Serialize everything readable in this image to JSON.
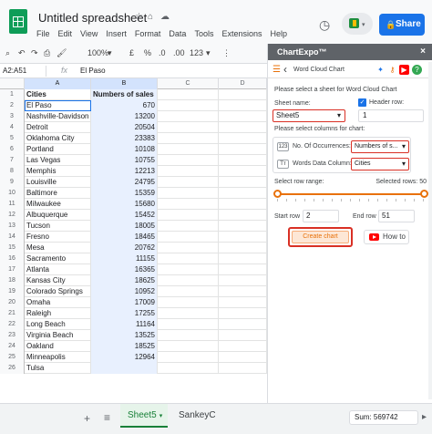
{
  "app": {
    "title": "Untitled spreadsheet",
    "share_label": "Share",
    "menus": [
      "File",
      "Edit",
      "View",
      "Insert",
      "Format",
      "Data",
      "Tools",
      "Extensions",
      "Help"
    ]
  },
  "toolbar": {
    "zoom": "100%",
    "currency": "£",
    "percent": "%",
    "decimal_dec": ".0",
    "decimal_inc": ".00",
    "number_format": "123"
  },
  "formula_bar": {
    "name_box": "A2:A51",
    "fx": "fx",
    "value": "El Paso"
  },
  "grid": {
    "columns": [
      "A",
      "B",
      "C",
      "D"
    ],
    "header": {
      "a": "Cities",
      "b": "Numbers of sales"
    },
    "rows": [
      {
        "n": "2",
        "city": "El Paso",
        "sales": "670"
      },
      {
        "n": "3",
        "city": "Nashville-Davidson",
        "sales": "13200"
      },
      {
        "n": "4",
        "city": "Detroit",
        "sales": "20504"
      },
      {
        "n": "5",
        "city": "Oklahoma City",
        "sales": "23383"
      },
      {
        "n": "6",
        "city": "Portland",
        "sales": "10108"
      },
      {
        "n": "7",
        "city": "Las Vegas",
        "sales": "10755"
      },
      {
        "n": "8",
        "city": "Memphis",
        "sales": "12213"
      },
      {
        "n": "9",
        "city": "Louisville",
        "sales": "24795"
      },
      {
        "n": "10",
        "city": "Baltimore",
        "sales": "15359"
      },
      {
        "n": "11",
        "city": "Milwaukee",
        "sales": "15680"
      },
      {
        "n": "12",
        "city": "Albuquerque",
        "sales": "15452"
      },
      {
        "n": "13",
        "city": "Tucson",
        "sales": "18005"
      },
      {
        "n": "14",
        "city": "Fresno",
        "sales": "18465"
      },
      {
        "n": "15",
        "city": "Mesa",
        "sales": "20762"
      },
      {
        "n": "16",
        "city": "Sacramento",
        "sales": "11155"
      },
      {
        "n": "17",
        "city": "Atlanta",
        "sales": "16365"
      },
      {
        "n": "18",
        "city": "Kansas City",
        "sales": "18625"
      },
      {
        "n": "19",
        "city": "Colorado Springs",
        "sales": "10952"
      },
      {
        "n": "20",
        "city": "Omaha",
        "sales": "17009"
      },
      {
        "n": "21",
        "city": "Raleigh",
        "sales": "17255"
      },
      {
        "n": "22",
        "city": "Long Beach",
        "sales": "11164"
      },
      {
        "n": "23",
        "city": "Virginia Beach",
        "sales": "13525"
      },
      {
        "n": "24",
        "city": "Oakland",
        "sales": "18525"
      },
      {
        "n": "25",
        "city": "Minneapolis",
        "sales": "12964"
      },
      {
        "n": "26",
        "city": "Tulsa",
        "sales": ""
      }
    ]
  },
  "sheets": {
    "active": "Sheet5",
    "other": "SankeyC",
    "sum": "Sum: 569742"
  },
  "panel": {
    "title": "ChartExpo™",
    "close": "×",
    "chart_name": "Word Cloud Chart",
    "select_sheet_label": "Please select a sheet for Word Cloud Chart",
    "sheet_name_label": "Sheet name:",
    "header_row_label": "Header row:",
    "sheet_value": "Sheet5",
    "header_row_value": "1",
    "select_columns_label": "Please select columns for chart:",
    "occurrences_icon": "123",
    "occurrences_label": "No. Of Occurrences:",
    "occurrences_value": "Numbers of s...",
    "words_icon": "Tт",
    "words_label": "Words Data Column:",
    "words_value": "Cities",
    "row_range_label": "Select row range:",
    "selected_rows": "Selected rows: 50",
    "start_row_label": "Start row",
    "start_row_value": "2",
    "end_row_label": "End row",
    "end_row_value": "51",
    "create_chart": "Create chart",
    "how_to": "How to"
  },
  "colors": {
    "accent": "#1a73e8",
    "sheets_green": "#0f9d58",
    "chartexpo_orange": "#e8710a",
    "highlight_red": "#d93025"
  }
}
